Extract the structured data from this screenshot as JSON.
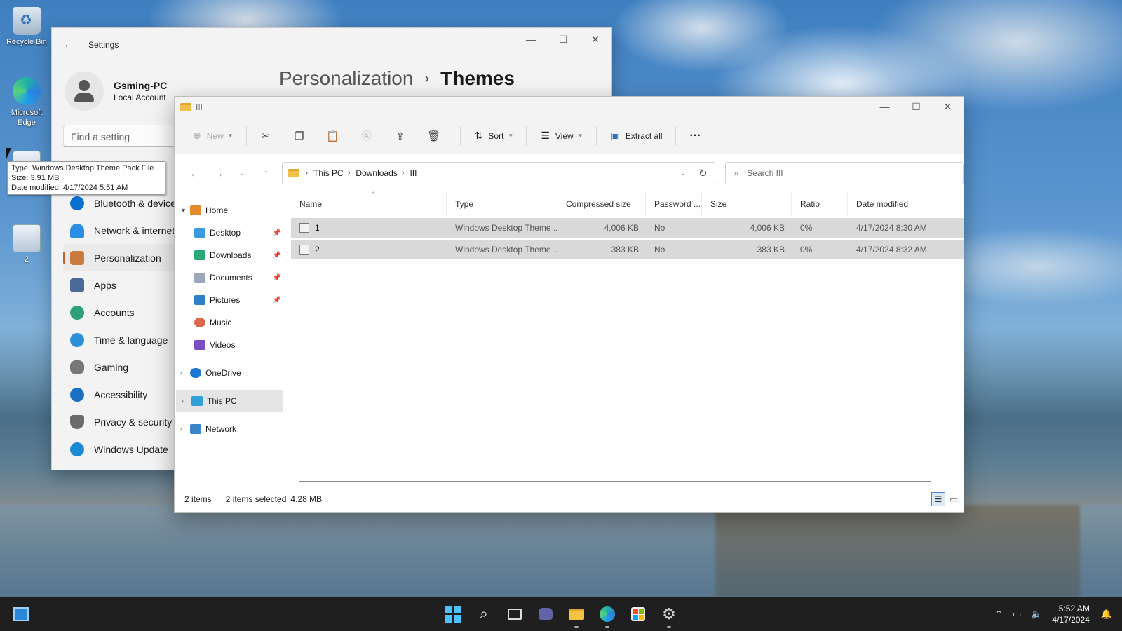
{
  "desktop": {
    "icons": [
      {
        "label": "Recycle Bin",
        "icon": "recycle-bin-icon"
      },
      {
        "label": "Microsoft Edge",
        "icon": "edge-icon"
      },
      {
        "label": "",
        "icon": "theme-pack-file-icon"
      },
      {
        "label": "2",
        "icon": "theme-pack-file-icon"
      }
    ],
    "tooltip": {
      "line1": "Type: Windows Desktop Theme Pack File",
      "line2": "Size: 3.91 MB",
      "line3": "Date modified: 4/17/2024 5:51 AM"
    }
  },
  "settings": {
    "title": "Settings",
    "profile_name": "Gsming-PC",
    "profile_type": "Local Account",
    "breadcrumb_parent": "Personalization",
    "breadcrumb_current": "Themes",
    "search_placeholder": "Find a setting",
    "nav": [
      {
        "label": "Bluetooth & devices",
        "icon": "bluetooth-icon",
        "color": "#0a6fd1"
      },
      {
        "label": "Network & internet",
        "icon": "wifi-icon",
        "color": "#2b8ee6"
      },
      {
        "label": "Personalization",
        "icon": "brush-icon",
        "color": "#c97a3d",
        "active": true
      },
      {
        "label": "Apps",
        "icon": "apps-icon",
        "color": "#4a6b9a"
      },
      {
        "label": "Accounts",
        "icon": "accounts-icon",
        "color": "#2ea07a"
      },
      {
        "label": "Time & language",
        "icon": "clock-globe-icon",
        "color": "#2d8fd6"
      },
      {
        "label": "Gaming",
        "icon": "gamepad-icon",
        "color": "#777777"
      },
      {
        "label": "Accessibility",
        "icon": "accessibility-icon",
        "color": "#1b6fc2"
      },
      {
        "label": "Privacy & security",
        "icon": "shield-icon",
        "color": "#6b6b6b"
      },
      {
        "label": "Windows Update",
        "icon": "update-icon",
        "color": "#1a8ad4"
      }
    ]
  },
  "explorer": {
    "title": "III",
    "toolbar": {
      "new_label": "New",
      "sort_label": "Sort",
      "view_label": "View",
      "extract_label": "Extract all",
      "more_label": "···"
    },
    "address": [
      "This PC",
      "Downloads",
      "III"
    ],
    "search_placeholder": "Search III",
    "tree": [
      {
        "label": "Home",
        "icon": "home-icon",
        "level": 0,
        "expand": "open"
      },
      {
        "label": "Desktop",
        "icon": "desktop-folder-icon",
        "level": 1,
        "pinned": true
      },
      {
        "label": "Downloads",
        "icon": "downloads-folder-icon",
        "level": 1,
        "pinned": true
      },
      {
        "label": "Documents",
        "icon": "documents-folder-icon",
        "level": 1,
        "pinned": true
      },
      {
        "label": "Pictures",
        "icon": "pictures-folder-icon",
        "level": 1,
        "pinned": true
      },
      {
        "label": "Music",
        "icon": "music-folder-icon",
        "level": 1
      },
      {
        "label": "Videos",
        "icon": "videos-folder-icon",
        "level": 1
      },
      {
        "label": "OneDrive",
        "icon": "onedrive-icon",
        "level": 0,
        "expand": "closed"
      },
      {
        "label": "This PC",
        "icon": "this-pc-icon",
        "level": 0,
        "expand": "closed",
        "selected": true
      },
      {
        "label": "Network",
        "icon": "network-icon",
        "level": 0,
        "expand": "closed"
      }
    ],
    "columns": [
      "Name",
      "Type",
      "Compressed size",
      "Password ...",
      "Size",
      "Ratio",
      "Date modified"
    ],
    "rows": [
      {
        "name": "1",
        "type": "Windows Desktop Theme ...",
        "compressed": "4,006 KB",
        "password": "No",
        "size": "4,006 KB",
        "ratio": "0%",
        "modified": "4/17/2024 8:30 AM"
      },
      {
        "name": "2",
        "type": "Windows Desktop Theme ...",
        "compressed": "383 KB",
        "password": "No",
        "size": "383 KB",
        "ratio": "0%",
        "modified": "4/17/2024 8:32 AM"
      }
    ],
    "status": {
      "items": "2 items",
      "selected": "2 items selected",
      "size": "4.28 MB"
    }
  },
  "taskbar": {
    "apps": [
      "start-icon",
      "search-icon",
      "task-view-icon",
      "teams-chat-icon",
      "file-explorer-icon",
      "edge-icon",
      "store-icon",
      "settings-gear-icon"
    ],
    "time": "5:52 AM",
    "date": "4/17/2024",
    "accent": "#4cc2ff"
  }
}
